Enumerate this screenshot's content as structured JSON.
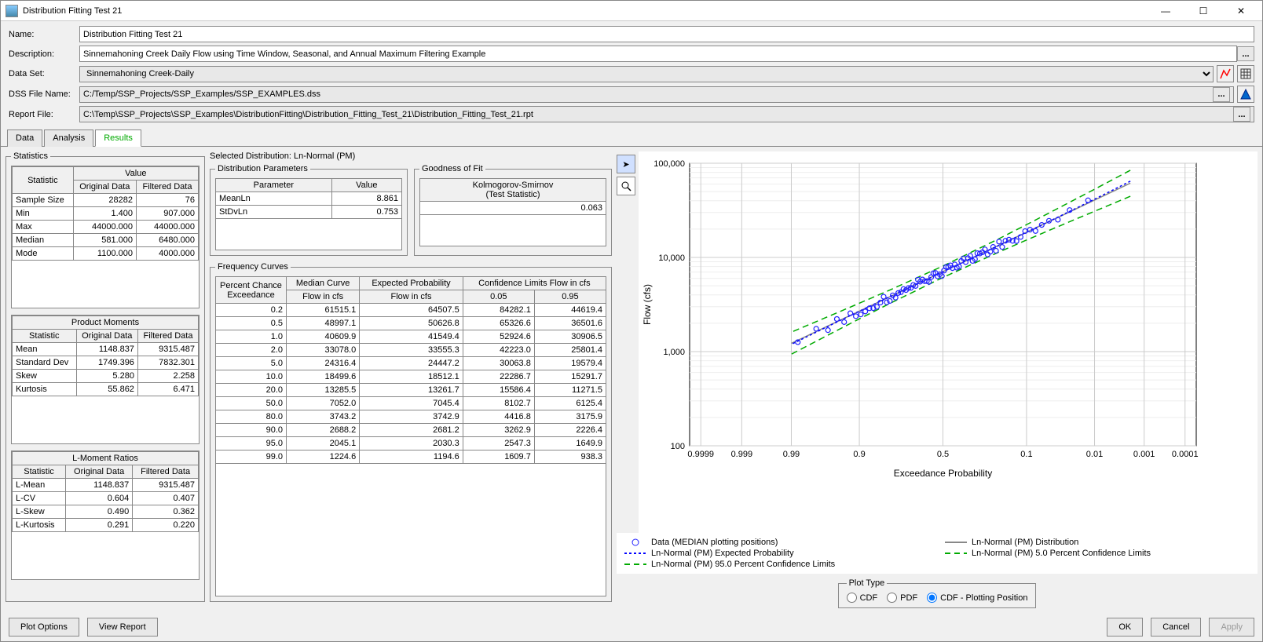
{
  "window": {
    "title": "Distribution Fitting Test 21"
  },
  "form": {
    "name_label": "Name:",
    "name_value": "Distribution Fitting Test 21",
    "desc_label": "Description:",
    "desc_value": "Sinnemahoning Creek Daily Flow using Time Window, Seasonal, and Annual Maximum Filtering Example",
    "dataset_label": "Data Set:",
    "dataset_value": "Sinnemahoning Creek-Daily",
    "dssfile_label": "DSS File Name:",
    "dssfile_value": "C:/Temp/SSP_Projects/SSP_Examples/SSP_EXAMPLES.dss",
    "report_label": "Report File:",
    "report_value": "C:\\Temp\\SSP_Projects\\SSP_Examples\\DistributionFitting\\Distribution_Fitting_Test_21\\Distribution_Fitting_Test_21.rpt",
    "browse": "..."
  },
  "tabs": {
    "data": "Data",
    "analysis": "Analysis",
    "results": "Results"
  },
  "stats": {
    "group_label": "Statistics",
    "h_stat": "Statistic",
    "h_value": "Value",
    "h_orig": "Original Data",
    "h_filt": "Filtered Data",
    "rows": [
      {
        "label": "Sample Size",
        "orig": "28282",
        "filt": "76"
      },
      {
        "label": "Min",
        "orig": "1.400",
        "filt": "907.000"
      },
      {
        "label": "Max",
        "orig": "44000.000",
        "filt": "44000.000"
      },
      {
        "label": "Median",
        "orig": "581.000",
        "filt": "6480.000"
      },
      {
        "label": "Mode",
        "orig": "1100.000",
        "filt": "4000.000"
      }
    ],
    "pm_title": "Product Moments",
    "pm_rows": [
      {
        "label": "Mean",
        "orig": "1148.837",
        "filt": "9315.487"
      },
      {
        "label": "Standard Dev",
        "orig": "1749.396",
        "filt": "7832.301"
      },
      {
        "label": "Skew",
        "orig": "5.280",
        "filt": "2.258"
      },
      {
        "label": "Kurtosis",
        "orig": "55.862",
        "filt": "6.471"
      }
    ],
    "lm_title": "L-Moment Ratios",
    "lm_rows": [
      {
        "label": "L-Mean",
        "orig": "1148.837",
        "filt": "9315.487"
      },
      {
        "label": "L-CV",
        "orig": "0.604",
        "filt": "0.407"
      },
      {
        "label": "L-Skew",
        "orig": "0.490",
        "filt": "0.362"
      },
      {
        "label": "L-Kurtosis",
        "orig": "0.291",
        "filt": "0.220"
      }
    ]
  },
  "selected_dist": {
    "label": "Selected Distribution: Ln-Normal (PM)",
    "dp_title": "Distribution Parameters",
    "dp_h1": "Parameter",
    "dp_h2": "Value",
    "dp_rows": [
      {
        "p": "MeanLn",
        "v": "8.861"
      },
      {
        "p": "StDvLn",
        "v": "0.753"
      }
    ],
    "gof_title": "Goodness of Fit",
    "gof_h1": "Kolmogorov-Smirnov",
    "gof_h2": "(Test Statistic)",
    "gof_val": "0.063"
  },
  "freq": {
    "title": "Frequency Curves",
    "h_pce": "Percent Chance Exceedance",
    "h_med": "Median Curve",
    "h_exp": "Expected Probability",
    "h_cl": "Confidence Limits Flow in cfs",
    "h_flow": "Flow in cfs",
    "h_05": "0.05",
    "h_95": "0.95",
    "rows": [
      {
        "p": "0.2",
        "m": "61515.1",
        "e": "64507.5",
        "c05": "84282.1",
        "c95": "44619.4"
      },
      {
        "p": "0.5",
        "m": "48997.1",
        "e": "50626.8",
        "c05": "65326.6",
        "c95": "36501.6"
      },
      {
        "p": "1.0",
        "m": "40609.9",
        "e": "41549.4",
        "c05": "52924.6",
        "c95": "30906.5"
      },
      {
        "p": "2.0",
        "m": "33078.0",
        "e": "33555.3",
        "c05": "42223.0",
        "c95": "25801.4"
      },
      {
        "p": "5.0",
        "m": "24316.4",
        "e": "24447.2",
        "c05": "30063.8",
        "c95": "19579.4"
      },
      {
        "p": "10.0",
        "m": "18499.6",
        "e": "18512.1",
        "c05": "22286.7",
        "c95": "15291.7"
      },
      {
        "p": "20.0",
        "m": "13285.5",
        "e": "13261.7",
        "c05": "15586.4",
        "c95": "11271.5"
      },
      {
        "p": "50.0",
        "m": "7052.0",
        "e": "7045.4",
        "c05": "8102.7",
        "c95": "6125.4"
      },
      {
        "p": "80.0",
        "m": "3743.2",
        "e": "3742.9",
        "c05": "4416.8",
        "c95": "3175.9"
      },
      {
        "p": "90.0",
        "m": "2688.2",
        "e": "2681.2",
        "c05": "3262.9",
        "c95": "2226.4"
      },
      {
        "p": "95.0",
        "m": "2045.1",
        "e": "2030.3",
        "c05": "2547.3",
        "c95": "1649.9"
      },
      {
        "p": "99.0",
        "m": "1224.6",
        "e": "1194.6",
        "c05": "1609.7",
        "c95": "938.3"
      }
    ]
  },
  "chart_data": {
    "type": "line",
    "title": "",
    "xlabel": "Exceedance Probability",
    "ylabel": "Flow (cfs)",
    "x_ticks": [
      "0.9999",
      "0.999",
      "0.99",
      "0.9",
      "0.5",
      "0.1",
      "0.01",
      "0.001",
      "0.0001"
    ],
    "y_ticks": [
      100,
      1000,
      10000,
      100000
    ],
    "ylim": [
      100,
      100000
    ],
    "legend": [
      "Data (MEDIAN plotting positions)",
      "Ln-Normal (PM) Distribution",
      "Ln-Normal (PM) Expected Probability",
      "Ln-Normal (PM) 5.0 Percent Confidence Limits",
      "Ln-Normal (PM) 95.0 Percent Confidence Limits"
    ],
    "series": [
      {
        "name": "Median Curve",
        "x": [
          0.2,
          0.5,
          1,
          2,
          5,
          10,
          20,
          50,
          80,
          90,
          95,
          99
        ],
        "y": [
          61515.1,
          48997.1,
          40609.9,
          33078.0,
          24316.4,
          18499.6,
          13285.5,
          7052.0,
          3743.2,
          2688.2,
          2045.1,
          1224.6
        ]
      },
      {
        "name": "Expected Probability",
        "x": [
          0.2,
          0.5,
          1,
          2,
          5,
          10,
          20,
          50,
          80,
          90,
          95,
          99
        ],
        "y": [
          64507.5,
          50626.8,
          41549.4,
          33555.3,
          24447.2,
          18512.1,
          13261.7,
          7045.4,
          3742.9,
          2681.2,
          2030.3,
          1194.6
        ]
      },
      {
        "name": "Confidence 0.05",
        "x": [
          0.2,
          0.5,
          1,
          2,
          5,
          10,
          20,
          50,
          80,
          90,
          95,
          99
        ],
        "y": [
          84282.1,
          65326.6,
          52924.6,
          42223.0,
          30063.8,
          22286.7,
          15586.4,
          8102.7,
          4416.8,
          3262.9,
          2547.3,
          1609.7
        ]
      },
      {
        "name": "Confidence 0.95",
        "x": [
          0.2,
          0.5,
          1,
          2,
          5,
          10,
          20,
          50,
          80,
          90,
          95,
          99
        ],
        "y": [
          44619.4,
          36501.6,
          30906.5,
          25801.4,
          19579.4,
          15291.7,
          11271.5,
          6125.4,
          3175.9,
          2226.4,
          1649.9,
          938.3
        ]
      }
    ]
  },
  "plot_type": {
    "label": "Plot Type",
    "cdf": "CDF",
    "pdf": "PDF",
    "cdfpp": "CDF - Plotting Position"
  },
  "footer": {
    "plot_options": "Plot Options",
    "view_report": "View Report",
    "ok": "OK",
    "cancel": "Cancel",
    "apply": "Apply"
  }
}
